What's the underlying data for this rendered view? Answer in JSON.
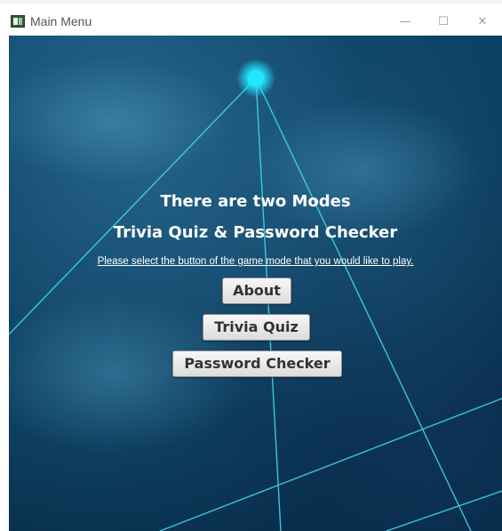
{
  "window": {
    "title": "Main Menu",
    "controls": {
      "minimize": "—",
      "maximize": "☐",
      "close": "✕"
    }
  },
  "main": {
    "heading_line1": "There are two Modes",
    "heading_line2": "Trivia Quiz & Password Checker",
    "instruction": "Please select the button of the game mode that you would like to play.",
    "buttons": {
      "about": "About",
      "trivia": "Trivia Quiz",
      "password": "Password Checker"
    }
  },
  "colors": {
    "background_dark": "#062743",
    "background_mid": "#0f4a6e",
    "line_color": "#3fd6e8",
    "glow_color": "#22e6ff",
    "heading_text": "#ffffff",
    "button_text": "#333333"
  }
}
